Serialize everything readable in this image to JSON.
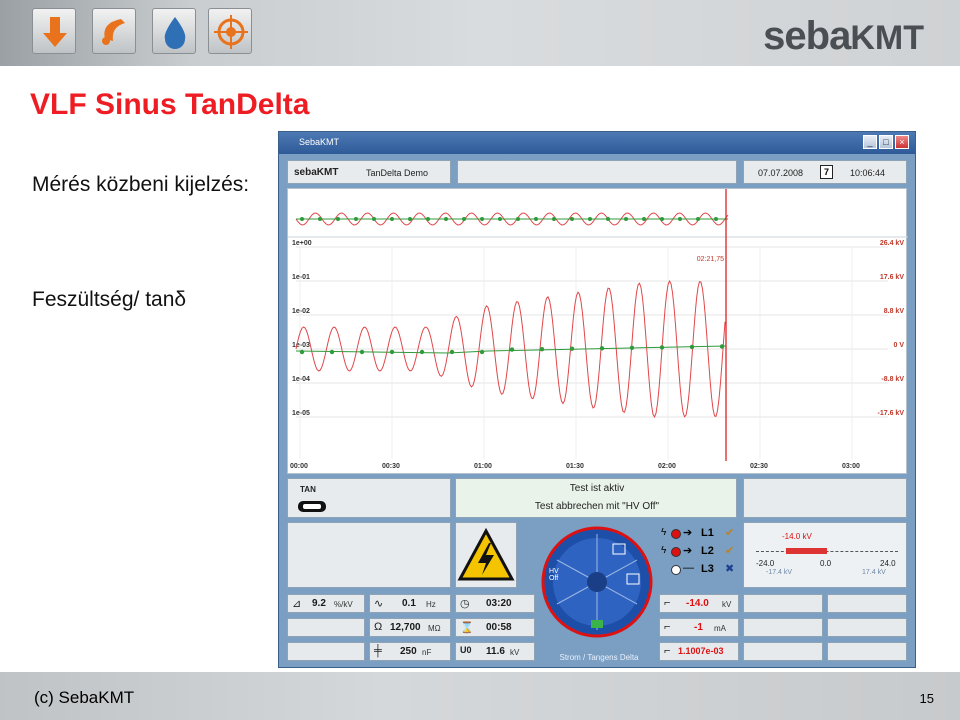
{
  "slide": {
    "title": "VLF Sinus TanDelta",
    "subtitle": "Mérés közbeni kijelzés:",
    "subtitle2": "Feszültség/ tanδ",
    "copyright": "(c) SebaKMT",
    "page_number": "15",
    "logo_main": "seba",
    "logo_kmt": "KMT",
    "nav_icons": [
      "down-arrow-icon",
      "phone-icon",
      "water-drop-icon",
      "target-icon"
    ]
  },
  "window": {
    "title": "SebaKMT",
    "brand": "sebaKMT",
    "app_name": "TanDelta Demo",
    "date": "07.07.2008",
    "calendar_day": "7",
    "time": "10:06:44"
  },
  "chart": {
    "cursor_time": "02:21,75",
    "left_ticks": [
      "1e+00",
      "1e-01",
      "1e-02",
      "1e-03",
      "1e-04",
      "1e-05"
    ],
    "right_ticks": [
      "26.4 kV",
      "17.6 kV",
      "8.8 kV",
      "0 V",
      "-8.8 kV",
      "-17.6 kV"
    ],
    "x_ticks": [
      "00:00",
      "00:30",
      "01:00",
      "01:30",
      "02:00",
      "02:30",
      "03:00"
    ]
  },
  "status": {
    "tan_label": "TAN",
    "line1": "Test ist aktiv",
    "line2": "Test abbrechen mit \"HV Off\""
  },
  "phases": [
    {
      "label": "L1",
      "mark": "✔",
      "state": "active"
    },
    {
      "label": "L2",
      "mark": "✔",
      "state": "active"
    },
    {
      "label": "L3",
      "mark": "✖",
      "state": "inactive"
    }
  ],
  "gauge": {
    "current": "-14.0 kV",
    "min": "-24.0",
    "mid": "0.0",
    "max": "24.0",
    "lower_limit": "-17.4 kV",
    "upper_limit": "17.4 kV",
    "level_fraction": 0.29
  },
  "dial": {
    "hv_off_label": "HV Off",
    "caption": "Strom / Tangens Delta"
  },
  "readings": {
    "tan_per_kv": {
      "value": "9.2",
      "unit": "%/kV"
    },
    "frequency": {
      "value": "0.1",
      "unit": "Hz"
    },
    "elapsed": {
      "value": "03:20"
    },
    "resistance": {
      "value": "12,700",
      "unit": "MΩ"
    },
    "remaining": {
      "value": "00:58"
    },
    "capacitance": {
      "value": "250",
      "unit": "nF"
    },
    "u0": {
      "label": "U0",
      "value": "11.6",
      "unit": "kV"
    },
    "voltage": {
      "value": "-14.0",
      "unit": "kV"
    },
    "current": {
      "value": "-1",
      "unit": "mA"
    },
    "tan_delta": {
      "value": "1.1007e-03"
    }
  },
  "colors": {
    "title_red": "#ee1d23",
    "wave_red": "#e0474a",
    "trend_green": "#2f9a3a",
    "window_blue": "#7a9fc2"
  }
}
